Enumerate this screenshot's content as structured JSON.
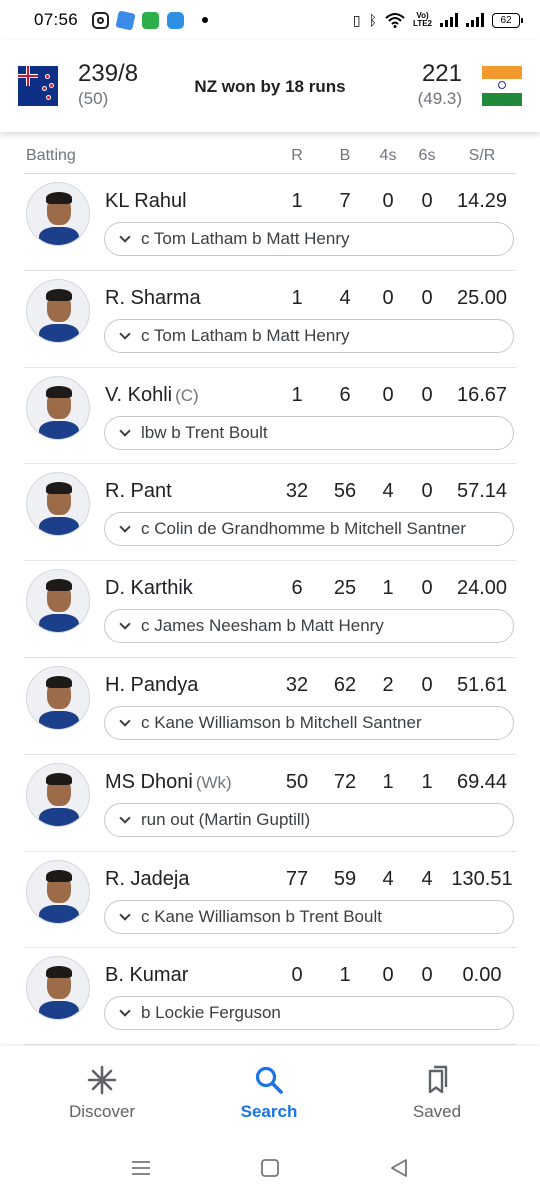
{
  "status_bar": {
    "time": "07:56",
    "app_icons": [
      "instagram-icon",
      "app-blue-icon",
      "app-green-icon",
      "cloud-app-icon"
    ],
    "network_label_top": "Vo)",
    "network_label_bottom": "LTE2",
    "battery": "62"
  },
  "score_header": {
    "team1": {
      "flag": "new-zealand-flag",
      "score": "239/8",
      "overs": "(50)"
    },
    "result": "NZ won by 18 runs",
    "team2": {
      "flag": "india-flag",
      "score": "221",
      "overs": "(49.3)"
    }
  },
  "batting": {
    "headers": {
      "title": "Batting",
      "runs": "R",
      "balls": "B",
      "fours": "4s",
      "sixes": "6s",
      "strike_rate": "S/R"
    },
    "players": [
      {
        "name": "KL Rahul",
        "role": "",
        "r": "1",
        "b": "7",
        "fours": "0",
        "sixes": "0",
        "sr": "14.29",
        "dismissal": "c Tom Latham b Matt Henry"
      },
      {
        "name": "R. Sharma",
        "role": "",
        "r": "1",
        "b": "4",
        "fours": "0",
        "sixes": "0",
        "sr": "25.00",
        "dismissal": "c Tom Latham b Matt Henry"
      },
      {
        "name": "V. Kohli",
        "role": "(C)",
        "r": "1",
        "b": "6",
        "fours": "0",
        "sixes": "0",
        "sr": "16.67",
        "dismissal": "lbw b Trent Boult"
      },
      {
        "name": "R. Pant",
        "role": "",
        "r": "32",
        "b": "56",
        "fours": "4",
        "sixes": "0",
        "sr": "57.14",
        "dismissal": "c Colin de Grandhomme b Mitchell Santner"
      },
      {
        "name": "D. Karthik",
        "role": "",
        "r": "6",
        "b": "25",
        "fours": "1",
        "sixes": "0",
        "sr": "24.00",
        "dismissal": "c James Neesham b Matt Henry"
      },
      {
        "name": "H. Pandya",
        "role": "",
        "r": "32",
        "b": "62",
        "fours": "2",
        "sixes": "0",
        "sr": "51.61",
        "dismissal": "c Kane Williamson b Mitchell Santner"
      },
      {
        "name": "MS Dhoni",
        "role": "(Wk)",
        "r": "50",
        "b": "72",
        "fours": "1",
        "sixes": "1",
        "sr": "69.44",
        "dismissal": "run out (Martin Guptill)"
      },
      {
        "name": "R. Jadeja",
        "role": "",
        "r": "77",
        "b": "59",
        "fours": "4",
        "sixes": "4",
        "sr": "130.51",
        "dismissal": "c Kane Williamson b Trent Boult"
      },
      {
        "name": "B. Kumar",
        "role": "",
        "r": "0",
        "b": "1",
        "fours": "0",
        "sixes": "0",
        "sr": "0.00",
        "dismissal": "b Lockie Ferguson"
      }
    ]
  },
  "bottom_nav": {
    "items": [
      {
        "label": "Discover",
        "icon": "asterisk-icon",
        "active": false
      },
      {
        "label": "Search",
        "icon": "search-icon",
        "active": true
      },
      {
        "label": "Saved",
        "icon": "bookmarks-icon",
        "active": false
      }
    ],
    "active_color": "#1a73e8"
  },
  "system_nav": {
    "buttons": [
      "recents-menu-icon",
      "home-square-icon",
      "back-triangle-icon"
    ]
  }
}
